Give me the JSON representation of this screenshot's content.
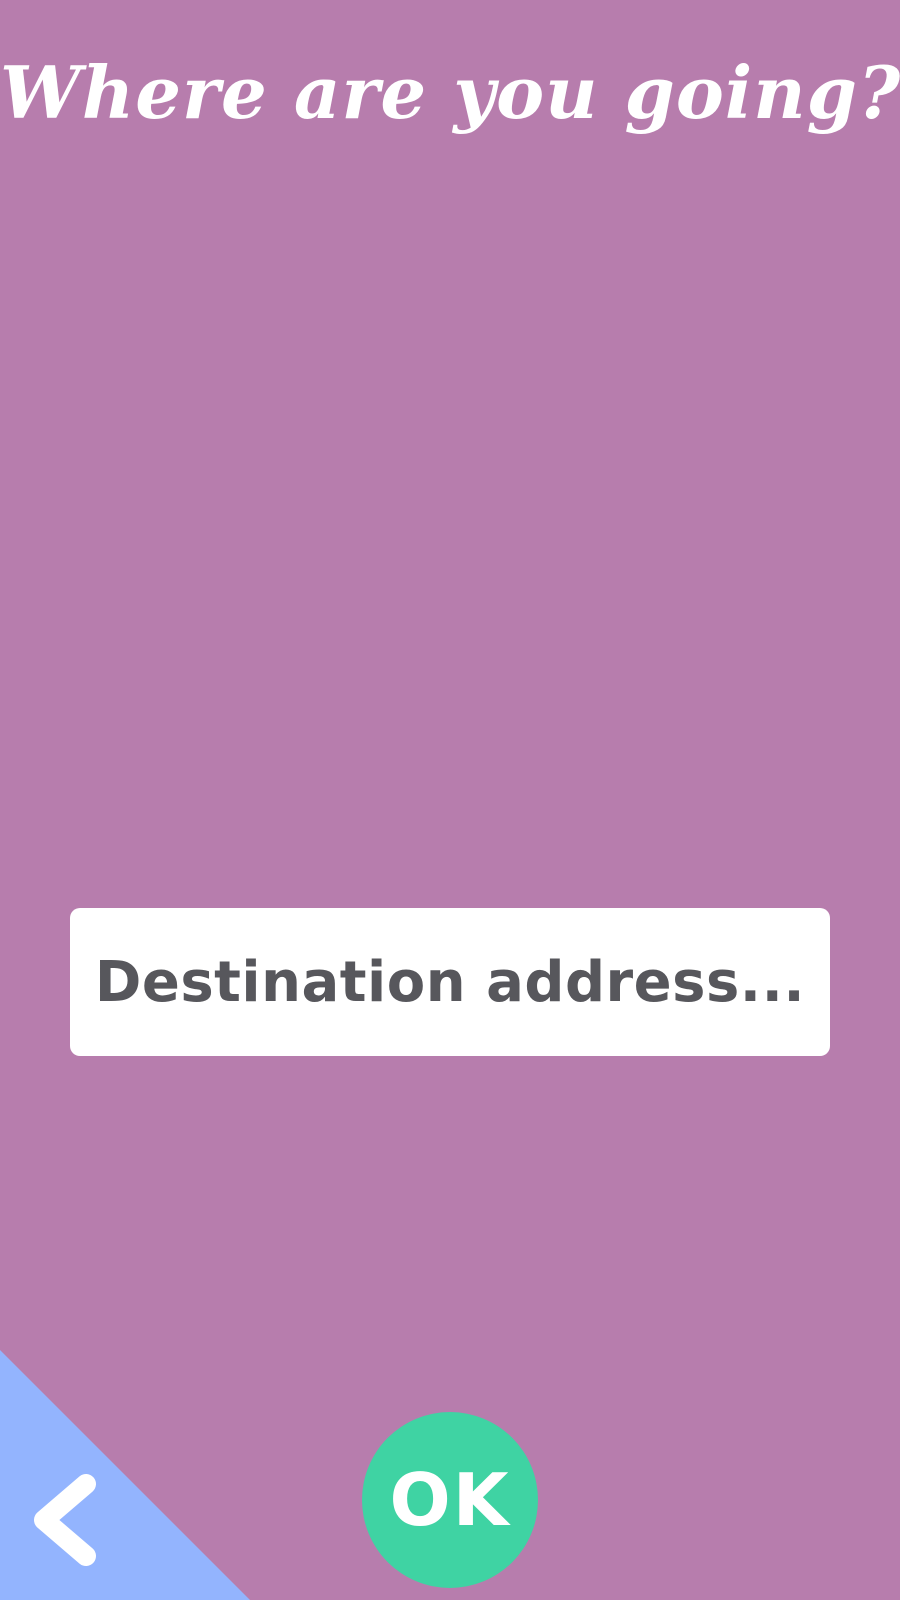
{
  "header": {
    "title": "Where are you going?"
  },
  "destination": {
    "placeholder": "Destination address..."
  },
  "footer": {
    "ok_label": "OK",
    "back_icon": "chevron-left-icon"
  },
  "colors": {
    "background": "#b77dad",
    "field": "#ffffff",
    "placeholder_text": "#57575c",
    "back_area": "#93b4fe",
    "ok_button": "#3fd3a3",
    "text_light": "#ffffff"
  }
}
